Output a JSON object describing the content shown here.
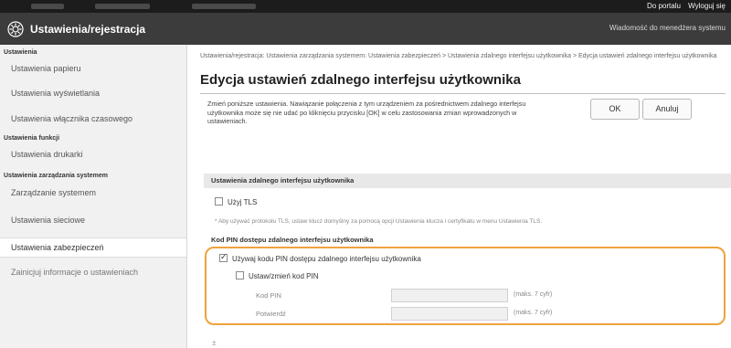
{
  "topbar": {
    "portal_link": "Do portalu",
    "logout_link": "Wyloguj się"
  },
  "header": {
    "app_icon": "gear-icon",
    "title": "Ustawienia/rejestracja",
    "admin_message": "Wiadomość do menedżera systemu"
  },
  "sidebar": {
    "groups": [
      {
        "heading": "Ustawienia",
        "items": [
          "Ustawienia papieru",
          "Ustawienia wyświetlania",
          "Ustawienia włącznika czasowego"
        ]
      },
      {
        "heading": "Ustawienia funkcji",
        "items": [
          "Ustawienia drukarki"
        ]
      },
      {
        "heading": "Ustawienia zarządzania systemem",
        "items": [
          "Zarządzanie systemem",
          "Ustawienia sieciowe",
          "Ustawienia zabezpieczeń",
          "Zainicjuj informacje o ustawieniach"
        ]
      }
    ],
    "active_item": "Ustawienia zabezpieczeń"
  },
  "main": {
    "breadcrumb": "Ustawienia/rejestracja: Ustawienia zarządzania systemem: Ustawienia zabezpieczeń > Ustawienia zdalnego interfejsu użytkownika > Edycja ustawień zdalnego interfejsu użytkownika",
    "page_title": "Edycja ustawień zdalnego interfejsu użytkownika",
    "intro_text": "Zmień poniższe ustawienia. Nawiązanie połączenia z tym urządzeniem za pośrednictwem zdalnego interfejsu użytkownika może się nie udać po kliknięciu przycisku [OK] w celu zastosowania zmian wprowadzonych w ustawieniach.",
    "ok_label": "OK",
    "cancel_label": "Anuluj",
    "section_title": "Ustawienia zdalnego interfejsu użytkownika",
    "use_tls": {
      "label": "Użyj TLS",
      "checked": false
    },
    "tls_note": "* Aby używać protokołu TLS, ustaw klucz domyślny za pomocą opcji Ustawienia klucza i certyfikatu w menu Ustawienia TLS.",
    "pin_section_title": "Kod PIN dostępu zdalnego interfejsu użytkownika",
    "use_pin": {
      "label": "Używaj kodu PIN dostępu zdalnego interfejsu użytkownika",
      "checked": true
    },
    "set_pin": {
      "label": "Ustaw/zmień kod PIN",
      "checked": false
    },
    "pin_field": {
      "label": "Kod PIN",
      "hint": "(maks. 7 cyfr)",
      "value": ""
    },
    "confirm_field": {
      "label": "Potwierdź",
      "hint": "(maks. 7 cyfr)",
      "value": ""
    },
    "accent_color": "#f0a23c",
    "bottom_mark": "±"
  }
}
